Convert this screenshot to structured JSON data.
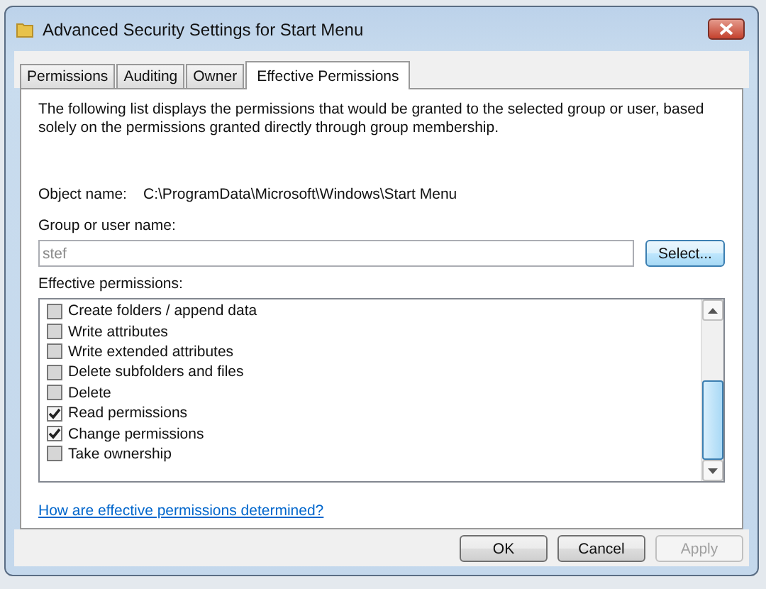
{
  "window": {
    "title": "Advanced Security Settings for Start Menu"
  },
  "tabs": [
    {
      "label": "Permissions",
      "selected": false
    },
    {
      "label": "Auditing",
      "selected": false
    },
    {
      "label": "Owner",
      "selected": false
    },
    {
      "label": "Effective Permissions",
      "selected": true
    }
  ],
  "description": "The following list displays the permissions that would be granted to the selected group or user, based solely on the permissions granted directly through group membership.",
  "object_name": {
    "label": "Object name:",
    "value": "C:\\ProgramData\\Microsoft\\Windows\\Start Menu"
  },
  "group_field": {
    "label": "Group or user name:",
    "value": "stef",
    "disabled": true
  },
  "select_button": "Select...",
  "permissions_label": "Effective permissions:",
  "permissions": [
    {
      "label": "Create folders / append data",
      "checked": false
    },
    {
      "label": "Write attributes",
      "checked": false
    },
    {
      "label": "Write extended attributes",
      "checked": false
    },
    {
      "label": "Delete subfolders and files",
      "checked": false
    },
    {
      "label": "Delete",
      "checked": false
    },
    {
      "label": "Read permissions",
      "checked": true
    },
    {
      "label": "Change permissions",
      "checked": true
    },
    {
      "label": "Take ownership",
      "checked": false
    }
  ],
  "help_link": "How are effective permissions determined?",
  "buttons": [
    {
      "label": "OK",
      "disabled": false
    },
    {
      "label": "Cancel",
      "disabled": false
    },
    {
      "label": "Apply",
      "disabled": true
    }
  ]
}
